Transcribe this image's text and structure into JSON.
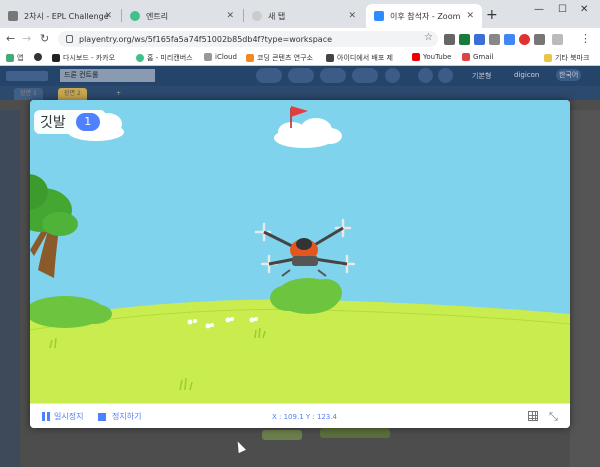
{
  "browser": {
    "tabs": [
      {
        "label": "2차시 - EPL Challenge",
        "active": false
      },
      {
        "label": "엔트리",
        "active": false
      },
      {
        "label": "새 탭",
        "active": false
      },
      {
        "label": "이후 참석자 - Zoom",
        "active": true
      }
    ],
    "url": "playentry.org/ws/5f165fa5a74f51002b85db4f?type=workspace",
    "bookmarks": [
      "앱",
      "",
      "다시보드 - 카카오",
      "홈 - 미리캔버스",
      "iCloud",
      "코딩 콘텐츠 연구소",
      "아이디에서 배포 제",
      "YouTube",
      "Gmail",
      "기타 북마크"
    ]
  },
  "entry": {
    "project_title": "드론 컨트롤",
    "scene_tabs": [
      "장면 1",
      "장면 2"
    ],
    "top_right": [
      "기본형",
      "digicon",
      "한국어"
    ]
  },
  "modal": {
    "variable": {
      "label": "깃발",
      "value": "1"
    },
    "pause_label": "일시정지",
    "stop_label": "정지하기",
    "coords": "X : 109.1  Y : 123.4"
  },
  "colors": {
    "accent": "#4f80ff",
    "sky": "#7fd3ec",
    "grass": "#c9ec4e"
  }
}
